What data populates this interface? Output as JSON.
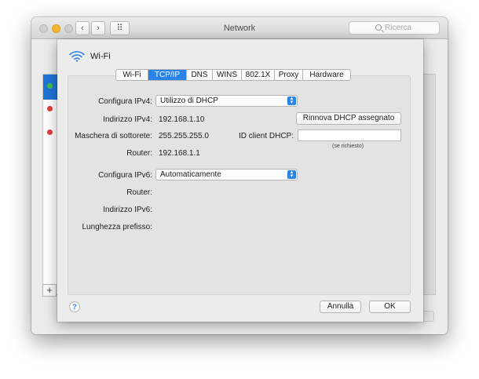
{
  "window": {
    "title": "Network",
    "search_placeholder": "Ricerca",
    "back_glyph": "‹",
    "forward_glyph": "›",
    "grid_glyph": "⠿",
    "plus_glyph": "+",
    "status_colors": [
      "#3ec43e",
      "#e0403a",
      "#e0403a"
    ]
  },
  "sheet": {
    "title": "Wi-Fi",
    "icon": "wifi-icon",
    "accent": "#2a84e8"
  },
  "tabs": [
    {
      "label": "Wi-Fi",
      "active": false
    },
    {
      "label": "TCP/IP",
      "active": true
    },
    {
      "label": "DNS",
      "active": false
    },
    {
      "label": "WINS",
      "active": false
    },
    {
      "label": "802.1X",
      "active": false
    },
    {
      "label": "Proxy",
      "active": false
    },
    {
      "label": "Hardware",
      "active": false
    }
  ],
  "form": {
    "ipv4_config_label": "Configura IPv4:",
    "ipv4_config_value": "Utilizzo di DHCP",
    "ipv4_address_label": "Indirizzo IPv4:",
    "ipv4_address_value": "192.168.1.10",
    "renew_button": "Rinnova DHCP assegnato",
    "subnet_label": "Maschera di sottorete:",
    "subnet_value": "255.255.255.0",
    "dhcp_client_label": "ID client DHCP:",
    "dhcp_client_value": "",
    "dhcp_client_hint": "(se richiesto)",
    "router_label": "Router:",
    "router_value": "192.168.1.1",
    "ipv6_config_label": "Configura IPv6:",
    "ipv6_config_value": "Automaticamente",
    "ipv6_router_label": "Router:",
    "ipv6_address_label": "Indirizzo IPv6:",
    "prefix_label": "Lunghezza prefisso:"
  },
  "footer": {
    "help": "?",
    "cancel": "Annulla",
    "ok": "OK"
  }
}
